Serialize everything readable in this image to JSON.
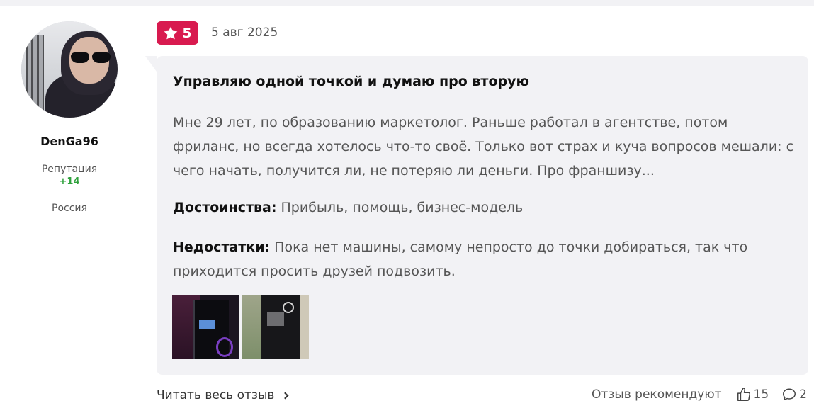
{
  "author": {
    "name": "DenGa96",
    "reputation_label": "Репутация",
    "reputation_value": "+14",
    "country": "Россия"
  },
  "review": {
    "rating": "5",
    "date": "5 авг 2025",
    "title": "Управляю одной точкой и думаю про вторую",
    "text": "Мне 29 лет, по образованию маркетолог. Раньше работал в агентстве, потом фриланс, но всегда хотелось что-то своё. Только вот страх и куча вопросов мешали: с чего начать, получится ли, не потеряю ли деньги. Про франшизу...",
    "pros_label": "Достоинства:",
    "pros": "Прибыль, помощь, бизнес-модель",
    "cons_label": "Недостатки:",
    "cons": "Пока нет машины, самому непросто до точки добираться, так что приходится просить друзей подвозить."
  },
  "footer": {
    "read_full": "Читать весь отзыв",
    "recommend_label": "Отзыв рекомендуют",
    "likes": "15",
    "comments": "2"
  },
  "colors": {
    "accent": "#d81a4f",
    "reputation": "#2fa13c",
    "bubble": "#f2f2f5"
  },
  "icons": [
    "star-icon",
    "thumbs-up-icon",
    "comment-icon",
    "chevron-right-icon"
  ]
}
